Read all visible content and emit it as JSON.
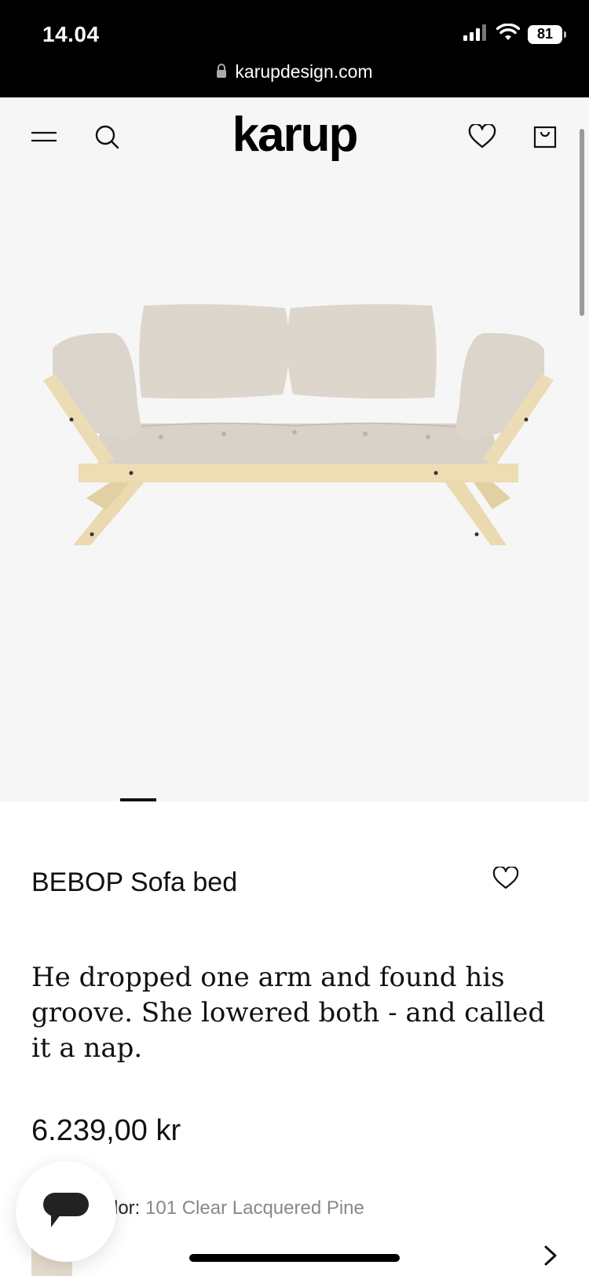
{
  "status_bar": {
    "time": "14.04",
    "battery": "81",
    "url": "karupdesign.com"
  },
  "header": {
    "logo": "karup",
    "icons": [
      "menu-icon",
      "search-icon",
      "heart-icon",
      "shopping-bag-icon"
    ]
  },
  "gallery": {
    "image": "sofa-product-image",
    "active_index": 1
  },
  "product": {
    "title": "BEBOP Sofa bed",
    "description": "He dropped one arm and found his groove. She lowered both - and called it a nap.",
    "price": "6.239,00 kr",
    "color_label": "lor:",
    "color_value": "101 Clear Lacquered Pine"
  },
  "colors": {
    "status_bar_bg": "#000000",
    "hero_bg": "#f6f6f6",
    "text": "#111111",
    "muted": "#888888",
    "wood": "#e9d9b4",
    "cushion": "#dcd5cc"
  }
}
